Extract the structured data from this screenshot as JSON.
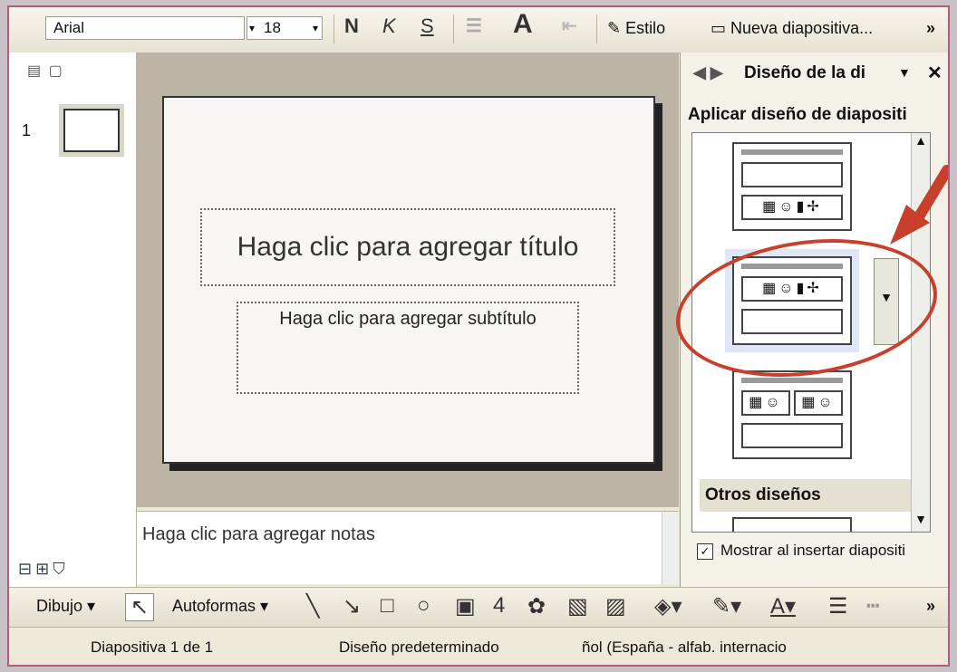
{
  "format_toolbar": {
    "font_name": "Arial",
    "font_size": "18",
    "bold_label": "N",
    "italic_label": "K",
    "underline_label": "S",
    "grow_font_label": "A",
    "style_label": "Estilo",
    "new_slide_label": "Nueva diapositiva...",
    "overflow_label": "»"
  },
  "slides_pane": {
    "slide_number": "1"
  },
  "slide": {
    "title_placeholder": "Haga clic para agregar título",
    "subtitle_placeholder": "Haga clic para agregar subtítulo"
  },
  "notes": {
    "placeholder": "Haga clic para agregar notas"
  },
  "task_pane": {
    "title": "Diseño de la di",
    "section_label": "Aplicar diseño de diapositi",
    "other_layouts_label": "Otros diseños",
    "show_on_insert_label": "Mostrar al insertar diapositi",
    "show_on_insert_checked": true
  },
  "drawing_toolbar": {
    "draw_label": "Dibujo",
    "autoshapes_label": "Autoformas"
  },
  "status_bar": {
    "slide_position": "Diapositiva 1 de 1",
    "design_name": "Diseño predeterminado",
    "language": "ñol (España - alfab. internacio"
  },
  "colors": {
    "annotation": "#c8402b",
    "window_bg": "#ece9d8",
    "selected_highlight": "#dfe6f6"
  }
}
